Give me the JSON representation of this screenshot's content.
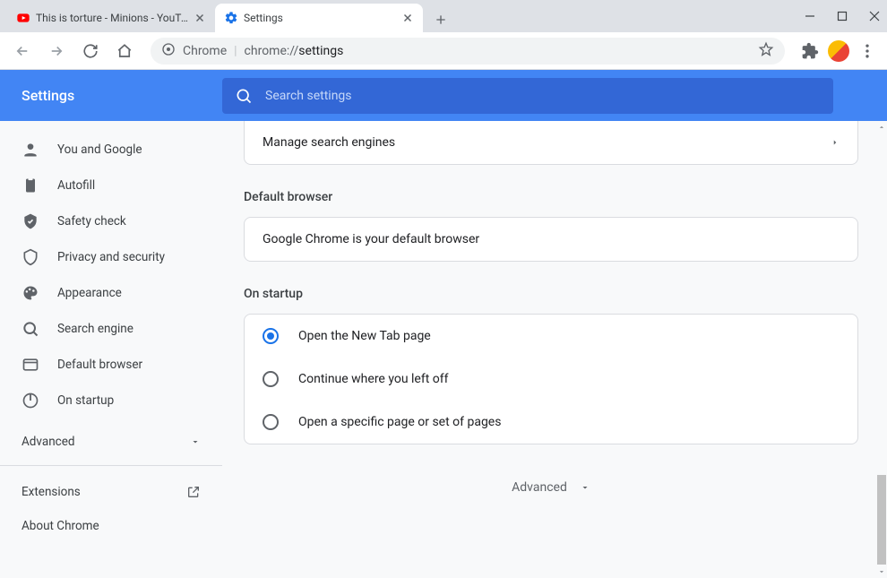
{
  "tabs": [
    {
      "title": "This is torture - Minions - YouTube",
      "favicon": "youtube"
    },
    {
      "title": "Settings",
      "favicon": "settings-gear"
    }
  ],
  "omnibox": {
    "chrome_label": "Chrome",
    "url_prefix": "chrome://",
    "url_path": "settings"
  },
  "header": {
    "title": "Settings"
  },
  "search": {
    "placeholder": "Search settings"
  },
  "sidebar": {
    "items": [
      {
        "icon": "person",
        "label": "You and Google"
      },
      {
        "icon": "autofill",
        "label": "Autofill"
      },
      {
        "icon": "safety",
        "label": "Safety check"
      },
      {
        "icon": "privacy",
        "label": "Privacy and security"
      },
      {
        "icon": "appearance",
        "label": "Appearance"
      },
      {
        "icon": "search",
        "label": "Search engine"
      },
      {
        "icon": "browser",
        "label": "Default browser"
      },
      {
        "icon": "power",
        "label": "On startup"
      }
    ],
    "advanced": "Advanced",
    "links": [
      {
        "label": "Extensions",
        "external": true
      },
      {
        "label": "About Chrome",
        "external": false
      }
    ]
  },
  "main": {
    "manage_search": "Manage search engines",
    "default_browser_title": "Default browser",
    "default_browser_text": "Google Chrome is your default browser",
    "startup_title": "On startup",
    "startup_options": [
      "Open the New Tab page",
      "Continue where you left off",
      "Open a specific page or set of pages"
    ],
    "startup_selected": 0,
    "advanced_footer": "Advanced"
  }
}
